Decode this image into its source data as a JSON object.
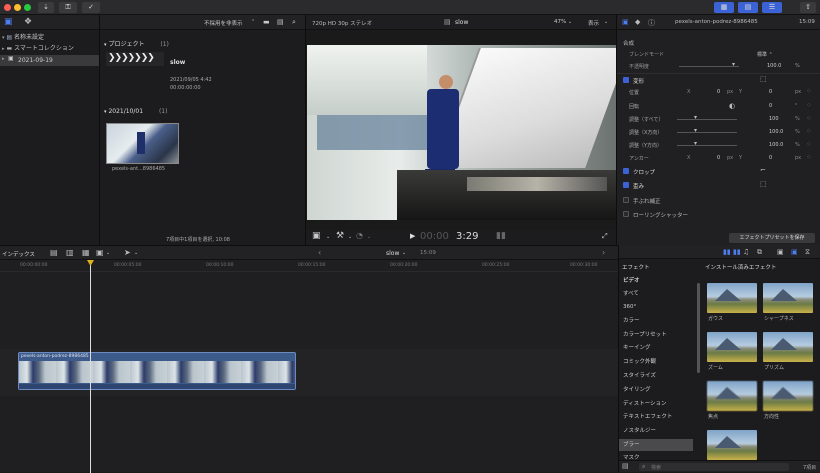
{
  "toolbar": {
    "buttons": [
      "download-icon",
      "key-icon",
      "check-icon"
    ],
    "right_buttons": [
      "grid-icon",
      "list-icon",
      "sliders-icon"
    ],
    "share_icon": "share-icon"
  },
  "library": {
    "header_icons": [
      "libraries-icon",
      "media-icon"
    ],
    "items": [
      {
        "label": "名称未設定",
        "indent": 0
      },
      {
        "label": "スマートコレクション",
        "indent": 1
      },
      {
        "label": "2021-09-19",
        "indent": 1,
        "selected": true
      }
    ]
  },
  "browser": {
    "filter_label": "不採用を非表示",
    "section1": {
      "title": "プロジェクト",
      "count": "(1)"
    },
    "project": {
      "name": "slow",
      "date": "2021/09/05 4:42",
      "duration": "00:00:00:00"
    },
    "section2": {
      "title": "2021/10/01",
      "count": "(1)"
    },
    "clip_label": "pexels-ant...8986485",
    "status": "7項目中1項目を選択, 10:08"
  },
  "viewer": {
    "format": "720p HD 30p ステレオ",
    "title": "slow",
    "zoom": "47%",
    "view_label": "表示",
    "timecode_dim": "00:00",
    "timecode": "3:29"
  },
  "inspector": {
    "clip_name": "pexels-anton-podrez-8986485",
    "duration": "15:09",
    "compositing": "合成",
    "blend_mode_label": "ブレンドモード",
    "blend_mode_value": "標準 ⌃",
    "opacity_label": "不透明度",
    "opacity_value": "100.0",
    "opacity_unit": "%",
    "transform_label": "変形",
    "rows": [
      {
        "label": "位置",
        "axis1": "X",
        "v1": "0",
        "u1": "px",
        "axis2": "Y",
        "v2": "0",
        "u2": "px"
      },
      {
        "label": "回転",
        "v1": "",
        "v2": "0",
        "u2": "°"
      },
      {
        "label": "調整（すべて）",
        "v2": "100",
        "u2": "%"
      },
      {
        "label": "調整（X方向）",
        "v2": "100.0",
        "u2": "%"
      },
      {
        "label": "調整（Y方向）",
        "v2": "100.0",
        "u2": "%"
      },
      {
        "label": "アンカー",
        "axis1": "X",
        "v1": "0",
        "u1": "px",
        "axis2": "Y",
        "v2": "0",
        "u2": "px"
      }
    ],
    "crop_label": "クロップ",
    "distort_label": "歪み",
    "stabilize_label": "手ぶれ補正",
    "rolling_label": "ローリングシャッター",
    "save_preset": "エフェクトプリセットを保存"
  },
  "timeline": {
    "index_label": "インデックス",
    "project_name": "slow",
    "project_duration": "15:09",
    "ruler": [
      "00:00:00:00",
      "00:00:05:00",
      "00:00:10:00",
      "00:00:15:00",
      "00:00:20:00",
      "00:00:25:00",
      "00:00:30:00"
    ],
    "clip_name": "pexels-anton-podrez-8986485"
  },
  "effects": {
    "header": "エフェクト",
    "installed": "インストール済みエフェクト",
    "categories": [
      "ビデオ",
      "すべて",
      "360°",
      "カラー",
      "カラープリセット",
      "キーイング",
      "コミック外観",
      "スタイライズ",
      "タイリング",
      "ディストーション",
      "テキストエフェクト",
      "ノスタルジー",
      "ブラー",
      "マスク"
    ],
    "selected_category": "ブラー",
    "items": [
      "ガウス",
      "シャープネス",
      "ズーム",
      "プリズム",
      "焦点",
      "方向性",
      ""
    ],
    "search_placeholder": "検索",
    "count": "7項目"
  },
  "colors": {
    "accent": "#3b63d6",
    "clip": "#3c5a8a",
    "playhead": "#e0b020"
  }
}
